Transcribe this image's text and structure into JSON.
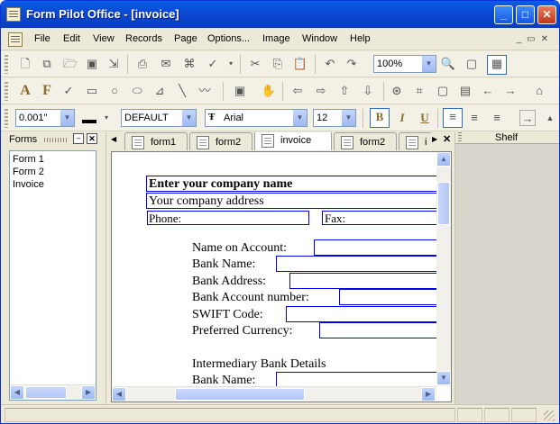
{
  "window": {
    "title": "Form Pilot Office - [invoice]"
  },
  "menu": [
    "File",
    "Edit",
    "View",
    "Records",
    "Page",
    "Options...",
    "Image",
    "Window",
    "Help"
  ],
  "toolbar3": {
    "line_width": "0.001\"",
    "style": "DEFAULT",
    "font": "Arial",
    "font_size": "12",
    "bold_label": "B",
    "italic_label": "I",
    "underline_label": "U"
  },
  "toolbar1": {
    "zoom": "100%"
  },
  "forms_panel": {
    "title": "Forms",
    "items": [
      "Form 1",
      "Form 2",
      "Invoice"
    ]
  },
  "tabs": [
    "form1",
    "form2",
    "invoice",
    "form2",
    "i"
  ],
  "shelf": {
    "title": "Shelf"
  },
  "document": {
    "company_name": "Enter your company name",
    "company_address": "Your company address",
    "phone_label": "Phone:",
    "fax_label": "Fax:",
    "fields": [
      "Name on Account:",
      "Bank Name:",
      "Bank Address:",
      "Bank Account number:",
      "SWIFT Code:",
      "Preferred Currency:"
    ],
    "intermediary_heading": "Intermediary Bank Details",
    "intermediary_bank_name": "Bank Name:"
  }
}
